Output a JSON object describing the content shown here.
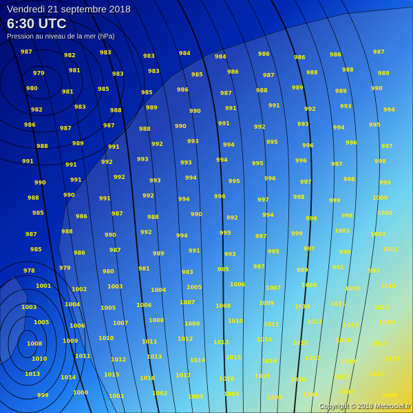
{
  "header": {
    "date": "Vendredi 21 septembre 2018",
    "time": "6:30 UTC",
    "subtitle": "Pression au niveau de la mer (hPa)"
  },
  "credit": "Copyright © 2018 Meteociel.fr",
  "colors": {
    "low": "#001a8a",
    "mid": "#1e90ff",
    "high_mid": "#7fe8ff",
    "high": "#ffd200",
    "land": "#b9b9b9",
    "label": "#ffee00",
    "isobar": "#000000"
  },
  "station_values": [
    987,
    982,
    983,
    983,
    984,
    984,
    986,
    986,
    986,
    987,
    979,
    981,
    983,
    983,
    985,
    986,
    987,
    988,
    988,
    989,
    980,
    981,
    985,
    985,
    986,
    987,
    988,
    989,
    989,
    990,
    982,
    983,
    988,
    989,
    990,
    991,
    991,
    992,
    993,
    994,
    986,
    987,
    987,
    988,
    990,
    991,
    992,
    993,
    994,
    995,
    988,
    989,
    991,
    992,
    993,
    994,
    995,
    996,
    996,
    997,
    991,
    991,
    992,
    993,
    993,
    994,
    995,
    996,
    997,
    998,
    990,
    991,
    992,
    993,
    994,
    995,
    996,
    997,
    998,
    999,
    988,
    990,
    991,
    992,
    994,
    996,
    997,
    998,
    999,
    1000,
    985,
    986,
    987,
    988,
    990,
    992,
    994,
    996,
    998,
    1000,
    987,
    988,
    990,
    992,
    994,
    995,
    997,
    999,
    1001,
    1002,
    985,
    986,
    987,
    989,
    991,
    993,
    995,
    997,
    999,
    1001,
    978,
    979,
    980,
    981,
    983,
    985,
    987,
    989,
    991,
    993,
    1001,
    1002,
    1003,
    1004,
    1005,
    1006,
    1007,
    1008,
    1009,
    1010,
    1003,
    1004,
    1005,
    1006,
    1007,
    1008,
    1009,
    1010,
    1011,
    1012,
    1005,
    1006,
    1007,
    1008,
    1009,
    1010,
    1011,
    1012,
    1013,
    1014,
    1008,
    1009,
    1010,
    1011,
    1012,
    1013,
    1014,
    1015,
    1016,
    1017,
    1010,
    1011,
    1012,
    1013,
    1014,
    1015,
    1016,
    1017,
    1018,
    1019,
    1013,
    1014,
    1015,
    1016,
    1017,
    1018,
    1019,
    1020,
    1021,
    1022,
    999,
    1000,
    1001,
    1002,
    1003,
    1004,
    1005,
    1006,
    1007,
    1008
  ]
}
